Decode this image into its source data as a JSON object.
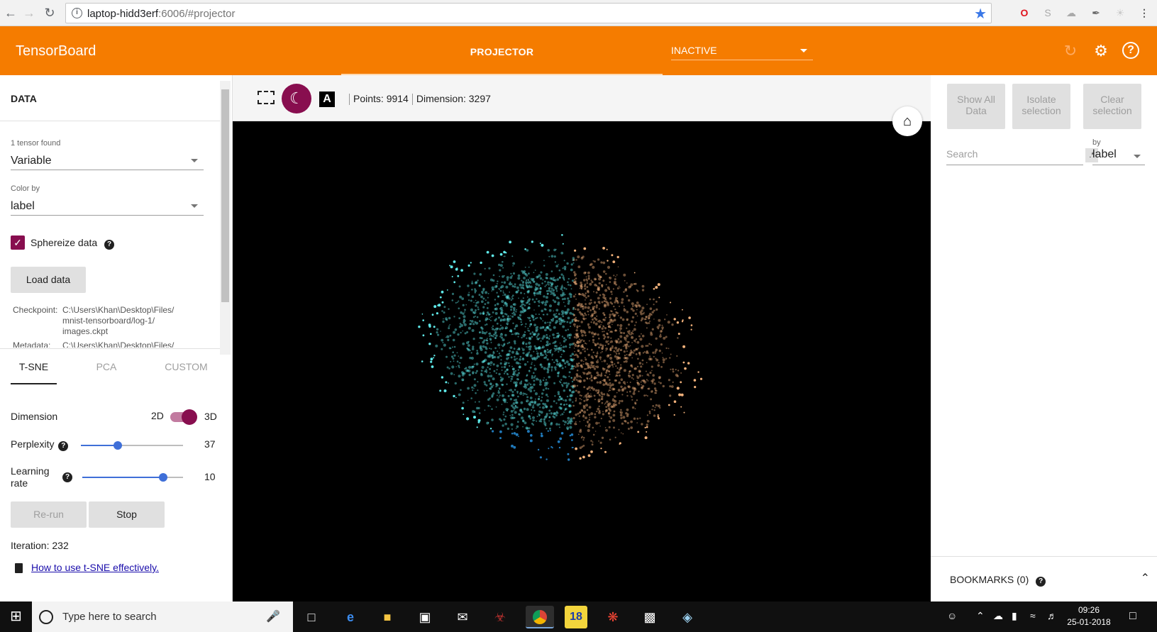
{
  "browser": {
    "url_host": "laptop-hidd3erf",
    "url_rest": ":6006/#projector"
  },
  "header": {
    "title": "TensorBoard",
    "tab_label": "PROJECTOR",
    "inactive_label": "INACTIVE"
  },
  "left": {
    "section_title": "DATA",
    "tensor_found": "1 tensor found",
    "tensor_value": "Variable",
    "color_by_label": "Color by",
    "color_by_value": "label",
    "sphereize_label": "Sphereize data",
    "load_data": "Load data",
    "checkpoint_key": "Checkpoint:",
    "checkpoint_lines": [
      "C:\\Users\\Khan\\Desktop\\Files/",
      "mnist-tensorboard/log-1/",
      "images.ckpt"
    ],
    "metadata_key": "Metadata:",
    "metadata_value": "C:\\Users\\Khan\\Desktop\\Files/",
    "tabs": [
      "T-SNE",
      "PCA",
      "CUSTOM"
    ],
    "dimension_label": "Dimension",
    "dim_2d": "2D",
    "dim_3d": "3D",
    "perplexity_label": "Perplexity",
    "perplexity_value": "37",
    "perplexity_fraction": 0.36,
    "learning_rate_label_1": "Learning",
    "learning_rate_label_2": "rate",
    "learning_rate_value": "10",
    "learning_rate_fraction": 0.8,
    "rerun": "Re-run",
    "stop": "Stop",
    "iteration": "Iteration: 232",
    "link": "How to use t-SNE effectively."
  },
  "center": {
    "points": "Points: 9914",
    "dimension": "Dimension: 3297",
    "label_icon": "A"
  },
  "right": {
    "show_all_1": "Show All",
    "show_all_2": "Data",
    "isolate_1": "Isolate",
    "isolate_2": "selection",
    "clear_1": "Clear",
    "clear_2": "selection",
    "search_placeholder": "Search",
    "regex": ".*",
    "by_label": "by",
    "by_value": "label",
    "bookmarks": "BOOKMARKS (0)"
  },
  "taskbar": {
    "search_placeholder": "Type here to search",
    "time": "09:26",
    "date": "25-01-2018",
    "badge_18": "18"
  },
  "colors": {
    "accent": "#f57c00",
    "toggle": "#880e4f",
    "slider": "#3f6fd8",
    "cyan": "#5ee8e8",
    "orange": "#f0b07a"
  }
}
